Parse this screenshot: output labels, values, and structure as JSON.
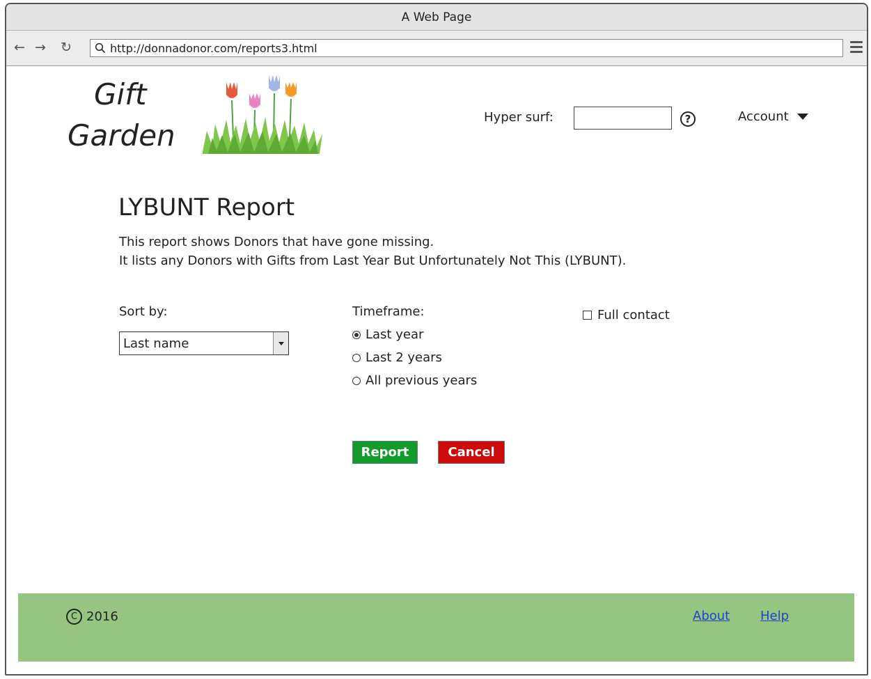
{
  "window": {
    "title": "A Web Page"
  },
  "browser": {
    "url": "http://donnadonor.com/reports3.html",
    "back_icon": "arrow-left",
    "forward_icon": "arrow-right",
    "reload_icon": "reload",
    "menu_icon": "hamburger"
  },
  "header": {
    "logo_line1": "Gift",
    "logo_line2": "Garden",
    "search_label": "Hyper surf:",
    "search_value": "",
    "help_glyph": "?",
    "account_label": "Account"
  },
  "main": {
    "title": "LYBUNT Report",
    "description_line1": "This report shows Donors that have gone missing.",
    "description_line2": "It lists any Donors with Gifts from Last Year But Unfortunately Not This (LYBUNT).",
    "sort": {
      "label": "Sort by:",
      "selected": "Last name"
    },
    "timeframe": {
      "label": "Timeframe:",
      "options": [
        {
          "label": "Last year",
          "checked": true
        },
        {
          "label": "Last 2 years",
          "checked": false
        },
        {
          "label": "All previous years",
          "checked": false
        }
      ]
    },
    "full_contact": {
      "label": "Full contact",
      "checked": false
    },
    "report_button": "Report",
    "cancel_button": "Cancel",
    "colors": {
      "report": "#129a2a",
      "cancel": "#cc0a0a",
      "footer": "#96c581",
      "link": "#1b46c8"
    }
  },
  "footer": {
    "copyright_symbol": "C",
    "year": "2016",
    "links": [
      "About",
      "Help"
    ]
  }
}
